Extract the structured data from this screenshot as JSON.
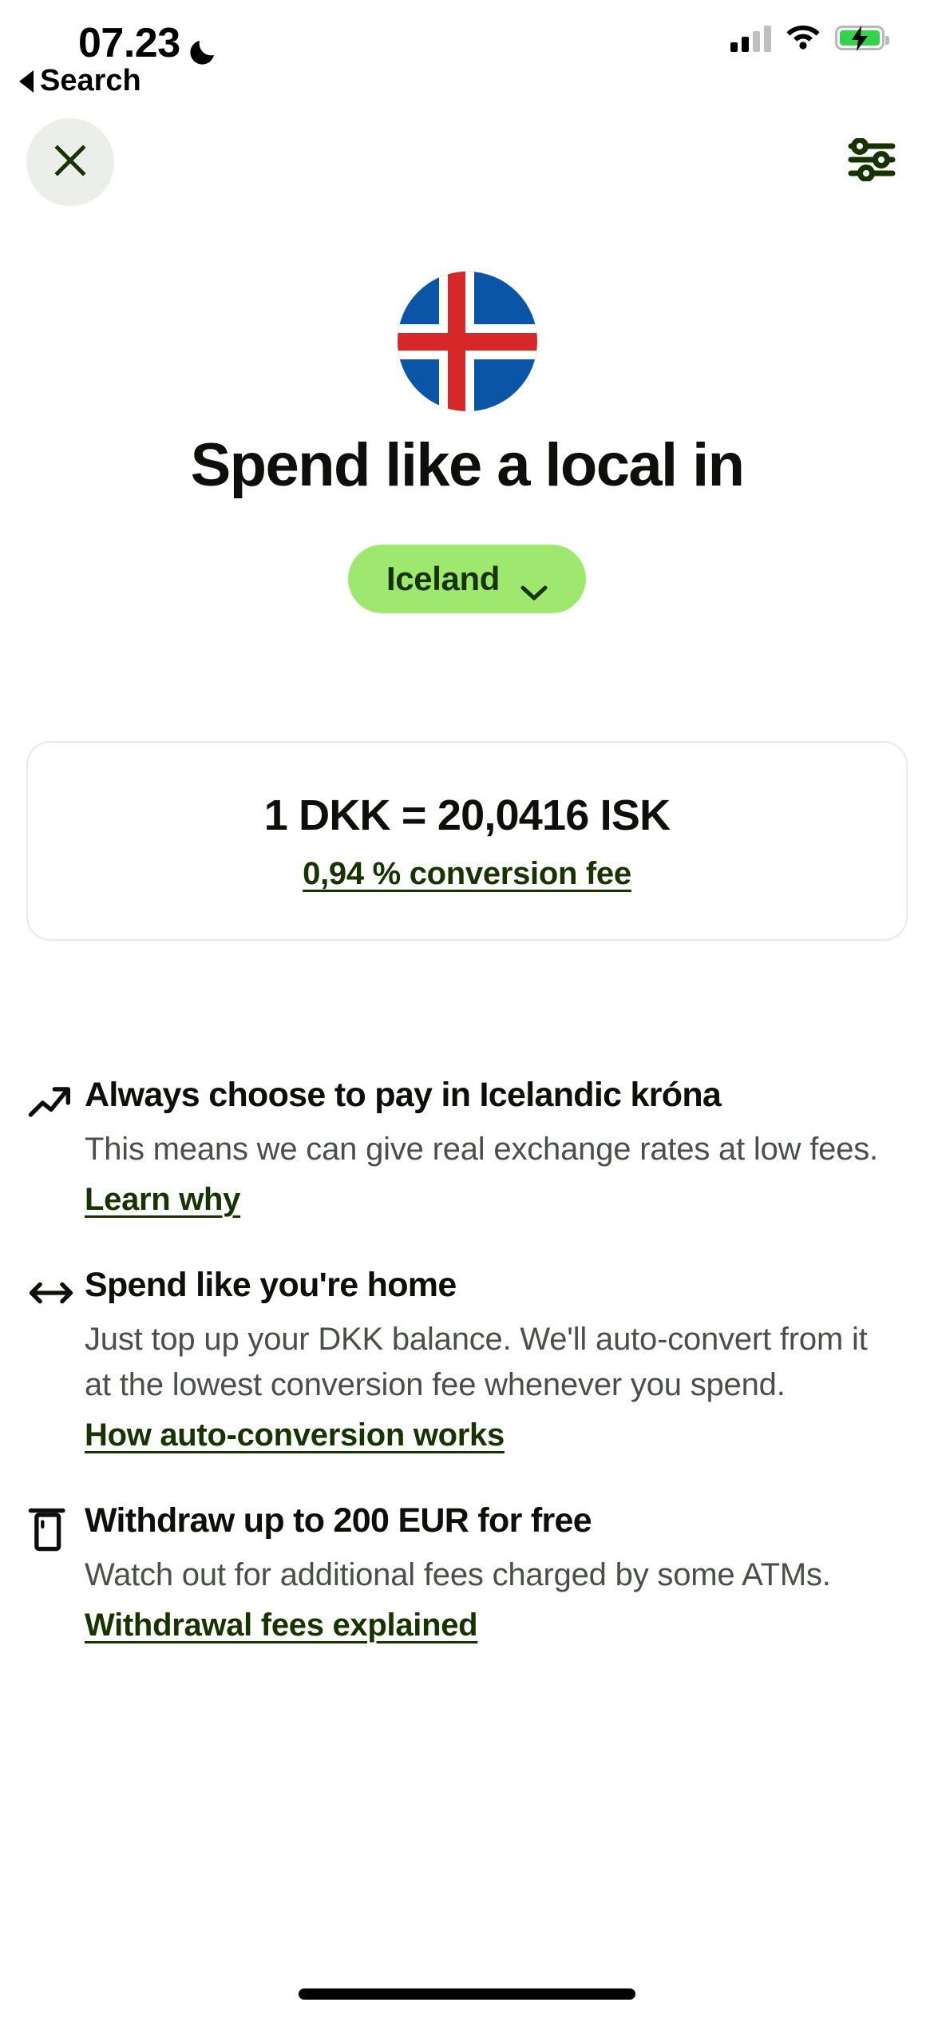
{
  "status_bar": {
    "time": "07.23",
    "dnd_icon": "moon-icon",
    "signal_icon": "cellular-signal-icon",
    "wifi_icon": "wifi-icon",
    "battery_icon": "battery-charging-icon"
  },
  "back_link": {
    "label": "Search",
    "icon": "back-triangle-icon"
  },
  "nav": {
    "close_icon": "close-x-icon",
    "settings_icon": "sliders-settings-icon"
  },
  "hero": {
    "flag_icon": "iceland-flag-icon",
    "headline": "Spend like a local in",
    "country": "Iceland",
    "chevron_icon": "chevron-down-icon"
  },
  "rate_card": {
    "rate": "1 DKK = 20,0416  ISK",
    "fee_link": "0,94 % conversion fee"
  },
  "features": [
    {
      "icon": "trending-up-icon",
      "title": "Always choose to pay in Icelandic króna",
      "description": "This means we can give real exchange rates at low fees.",
      "link": "Learn why"
    },
    {
      "icon": "left-right-arrow-icon",
      "title": "Spend like you're home",
      "description": "Just top up your DKK balance. We'll auto-convert from it at the lowest conversion fee whenever you spend.",
      "link": "How auto-conversion works"
    },
    {
      "icon": "atm-machine-icon",
      "title": "Withdraw up to 200 EUR for free",
      "description": "Watch out for additional fees charged by some ATMs.",
      "link": "Withdrawal fees explained"
    }
  ],
  "colors": {
    "brand_green": "#9fe870",
    "dark_green": "#163300",
    "text_primary": "#0e0f0c",
    "text_secondary": "#4a4f49",
    "card_border": "#e8eae7",
    "close_bg": "#eceee9",
    "flag_blue": "#0a55a5",
    "flag_red": "#d72828"
  }
}
